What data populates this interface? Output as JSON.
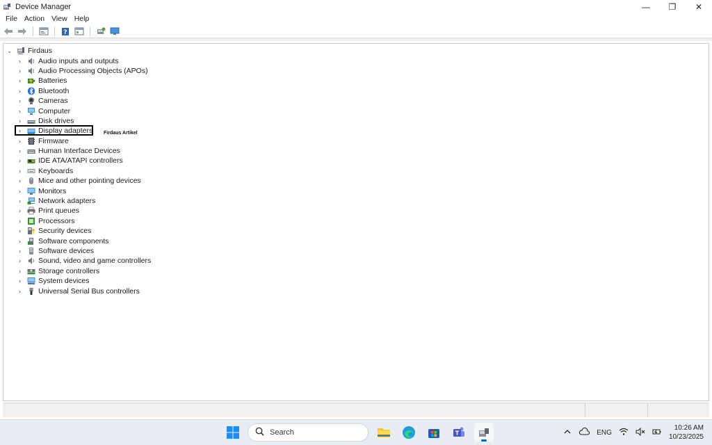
{
  "window": {
    "title": "Device Manager",
    "controls": [
      "—",
      "❐",
      "✕"
    ]
  },
  "menu": [
    "File",
    "Action",
    "View",
    "Help"
  ],
  "tree": {
    "root": "Firdaus",
    "items": [
      {
        "label": "Audio inputs and outputs",
        "icon": "speaker-icon"
      },
      {
        "label": "Audio Processing Objects (APOs)",
        "icon": "speaker-icon"
      },
      {
        "label": "Batteries",
        "icon": "battery-icon"
      },
      {
        "label": "Bluetooth",
        "icon": "bluetooth-icon"
      },
      {
        "label": "Cameras",
        "icon": "camera-icon"
      },
      {
        "label": "Computer",
        "icon": "computer-icon"
      },
      {
        "label": "Disk drives",
        "icon": "disk-drive-icon"
      },
      {
        "label": "Display adapters",
        "icon": "display-adapter-icon"
      },
      {
        "label": "Firmware",
        "icon": "firmware-icon"
      },
      {
        "label": "Human Interface Devices",
        "icon": "hid-icon"
      },
      {
        "label": "IDE ATA/ATAPI controllers",
        "icon": "ide-controller-icon"
      },
      {
        "label": "Keyboards",
        "icon": "keyboard-icon"
      },
      {
        "label": "Mice and other pointing devices",
        "icon": "mouse-icon"
      },
      {
        "label": "Monitors",
        "icon": "monitor-icon"
      },
      {
        "label": "Network adapters",
        "icon": "network-adapter-icon"
      },
      {
        "label": "Print queues",
        "icon": "printer-icon"
      },
      {
        "label": "Processors",
        "icon": "processor-icon"
      },
      {
        "label": "Security devices",
        "icon": "security-device-icon"
      },
      {
        "label": "Software components",
        "icon": "software-component-icon"
      },
      {
        "label": "Software devices",
        "icon": "software-device-icon"
      },
      {
        "label": "Sound, video and game controllers",
        "icon": "sound-controller-icon"
      },
      {
        "label": "Storage controllers",
        "icon": "storage-controller-icon"
      },
      {
        "label": "System devices",
        "icon": "system-device-icon"
      },
      {
        "label": "Universal Serial Bus controllers",
        "icon": "usb-icon"
      }
    ]
  },
  "annotation": {
    "watermark": "Firdaus Artikel"
  },
  "taskbar": {
    "search_placeholder": "Search",
    "language": "ENG",
    "time": "10:26 AM",
    "date": "10/23/2025"
  },
  "colors": {
    "accent": "#0067c0",
    "selection_box": "#000000"
  }
}
